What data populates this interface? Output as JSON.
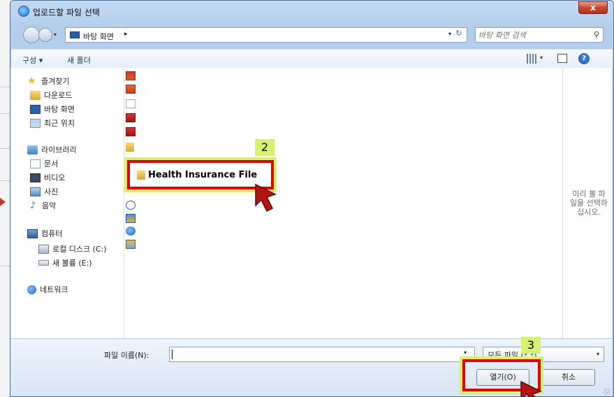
{
  "window": {
    "title": "업로드할 파일 선택",
    "close_label": "x"
  },
  "address_bar": {
    "location": "바탕 화면",
    "chevron": "▸",
    "dropdown": "▾",
    "refresh": "↻"
  },
  "search": {
    "placeholder": "바탕 화면 검색",
    "icon": "search-icon"
  },
  "toolbar": {
    "organize_label": "구성 ▾",
    "new_folder_label": "새 폴더",
    "views_dropdown": "▾",
    "help_label": "?"
  },
  "nav_pane": {
    "favorites": "즐겨찾기",
    "downloads": "다운로드",
    "desktop": "바탕 화면",
    "recent": "최근 위치",
    "libraries": "라이브러리",
    "documents": "문서",
    "videos": "비디오",
    "pictures": "사진",
    "music": "음악",
    "computer": "컴퓨터",
    "local_disk": "로컬 디스크 (C:)",
    "new_volume": "새 볼륨 (E:)",
    "network": "네트워크"
  },
  "file_pane": {
    "highlighted_file": "Health Insurance File"
  },
  "preview": {
    "text": "미리 볼 파\n일을 선택하\n십시오."
  },
  "bottom": {
    "filename_label": "파일 이름(N):",
    "filename_value": "",
    "filetype_value": "모든 파일 (*.*)",
    "open_label": "열기(O)",
    "cancel_label": "취소"
  },
  "annotations": {
    "step2": "2",
    "step3": "3",
    "highlight_color": "#e30000",
    "badge_color": "#d8f070"
  }
}
